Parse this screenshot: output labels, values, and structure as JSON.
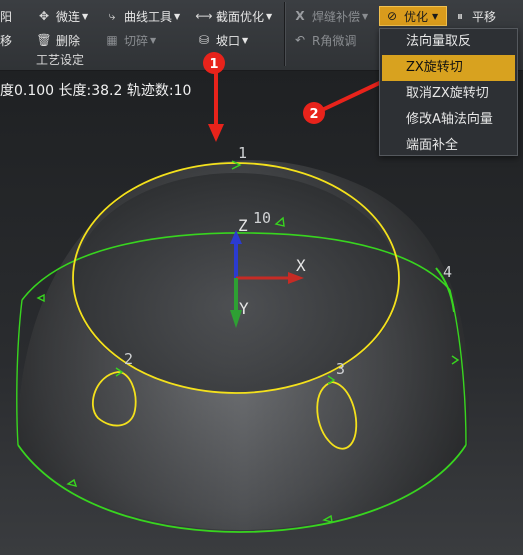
{
  "toolbar": {
    "left_edge_top": "阳",
    "left_edge_bottom": "移",
    "micro_connect": "微连",
    "curve_tools": "曲线工具",
    "section_optimize": "截面优化",
    "delete": "删除",
    "cut_break": "切碎",
    "bevel": "坡口",
    "group_label": "工艺设定",
    "weld_compensate": "焊缝补偿",
    "r_corner_fine": "R角微调",
    "optimize": "优化",
    "translate": "平移"
  },
  "status_text": "度0.100 长度:38.2 轨迹数:10",
  "dropdown": {
    "items": [
      {
        "label": "法向量取反"
      },
      {
        "label": "ZX旋转切"
      },
      {
        "label": "取消ZX旋转切"
      },
      {
        "label": "修改A轴法向量"
      },
      {
        "label": "端面补全"
      }
    ],
    "highlighted_index": 1
  },
  "annotations": {
    "marker_1": "1",
    "marker_2": "2"
  },
  "scene": {
    "path_labels": [
      "1",
      "10",
      "2",
      "3",
      "4"
    ],
    "axis_labels": {
      "x": "X",
      "y": "Y",
      "z": "Z"
    },
    "colors": {
      "selected_path": "#f4e11c",
      "other_path": "#38d51f",
      "annotation_red": "#e8231b",
      "menu_highlight": "#d8a21f"
    }
  }
}
